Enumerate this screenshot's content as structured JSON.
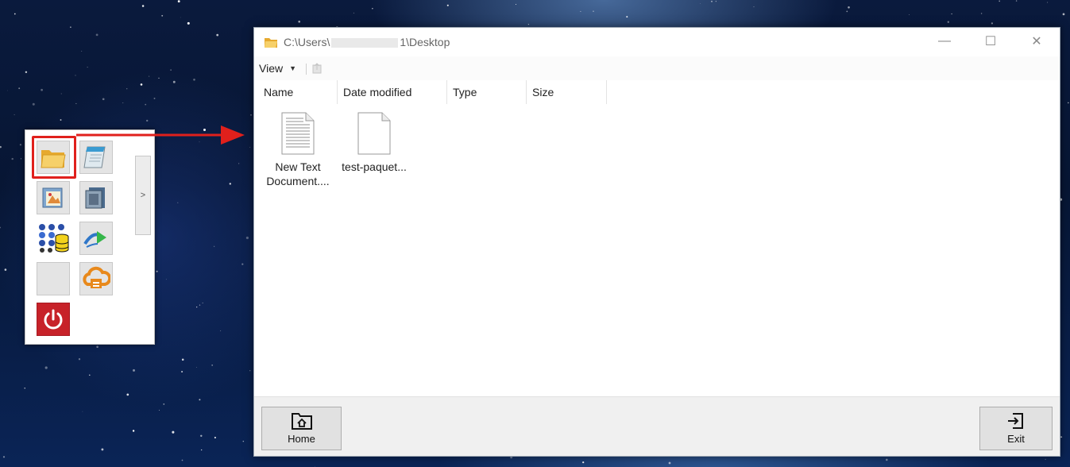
{
  "window": {
    "title_prefix": "C:\\Users\\",
    "title_suffix": "1\\Desktop",
    "controls": {
      "minimize": "—",
      "maximize": "☐",
      "close": "✕"
    }
  },
  "toolbar": {
    "view_label": "View",
    "view_caret": "▼"
  },
  "columns": [
    "Name",
    "Date modified",
    "Type",
    "Size"
  ],
  "files": [
    {
      "name": "New Text Document....",
      "icon": "text-document-icon"
    },
    {
      "name": "test-paquet...",
      "icon": "blank-file-icon"
    }
  ],
  "bottom": {
    "home_label": "Home",
    "exit_label": "Exit"
  },
  "launcher": {
    "expand_label": ">",
    "items": [
      "folder-icon",
      "notepad-icon",
      "paint-icon",
      "chip-icon",
      "database-icon",
      "share-arrow-icon",
      "empty-slot",
      "cloud-printer-icon",
      "power-icon"
    ]
  },
  "colors": {
    "highlight": "#e0201c",
    "power": "#c72229",
    "folder": "#f2c14a"
  }
}
